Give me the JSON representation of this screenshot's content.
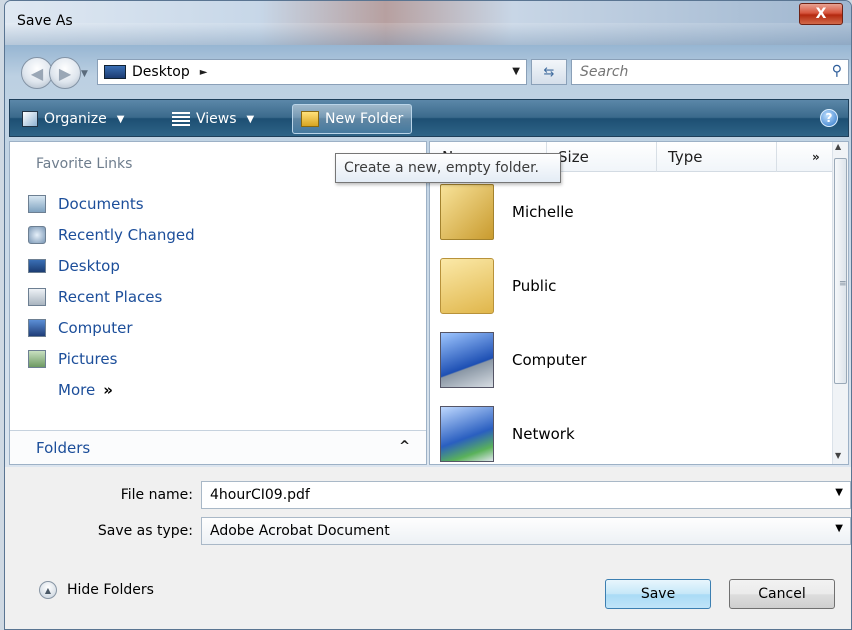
{
  "window": {
    "title": "Save As",
    "close_label": "X"
  },
  "nav": {
    "back_glyph": "◀",
    "forward_glyph": "▶",
    "address": "Desktop",
    "address_arrow": "►",
    "search_placeholder": "Search"
  },
  "toolbar": {
    "organize": "Organize",
    "views": "Views",
    "new_folder": "New Folder",
    "help": "?"
  },
  "tooltip": "Create a new, empty folder.",
  "favorites": {
    "title": "Favorite Links",
    "items": [
      {
        "label": "Documents",
        "icon": "documents-icon"
      },
      {
        "label": "Recently Changed",
        "icon": "recently-changed-icon"
      },
      {
        "label": "Desktop",
        "icon": "desktop-icon"
      },
      {
        "label": "Recent Places",
        "icon": "recent-places-icon"
      },
      {
        "label": "Computer",
        "icon": "computer-icon"
      },
      {
        "label": "Pictures",
        "icon": "pictures-icon"
      }
    ],
    "more": "More",
    "more_chevron": "»",
    "folders_label": "Folders",
    "folders_chevron": "^"
  },
  "file_list": {
    "columns": {
      "name": "Name",
      "size": "Size",
      "type": "Type",
      "more": "»"
    },
    "items": [
      {
        "name": "Michelle",
        "icon": "user-folder-icon"
      },
      {
        "name": "Public",
        "icon": "folder-icon"
      },
      {
        "name": "Computer",
        "icon": "computer-icon"
      },
      {
        "name": "Network",
        "icon": "network-icon"
      }
    ]
  },
  "form": {
    "file_name_label": "File name:",
    "file_name_value": "4hourCI09.pdf",
    "save_type_label": "Save as type:",
    "save_type_value": "Adobe Acrobat Document"
  },
  "footer": {
    "hide_folders": "Hide Folders",
    "save": "Save",
    "cancel": "Cancel"
  },
  "colors": {
    "link": "#1c4e9a",
    "toolbar": "#2e6487",
    "save_button": "#c5e7f8"
  }
}
